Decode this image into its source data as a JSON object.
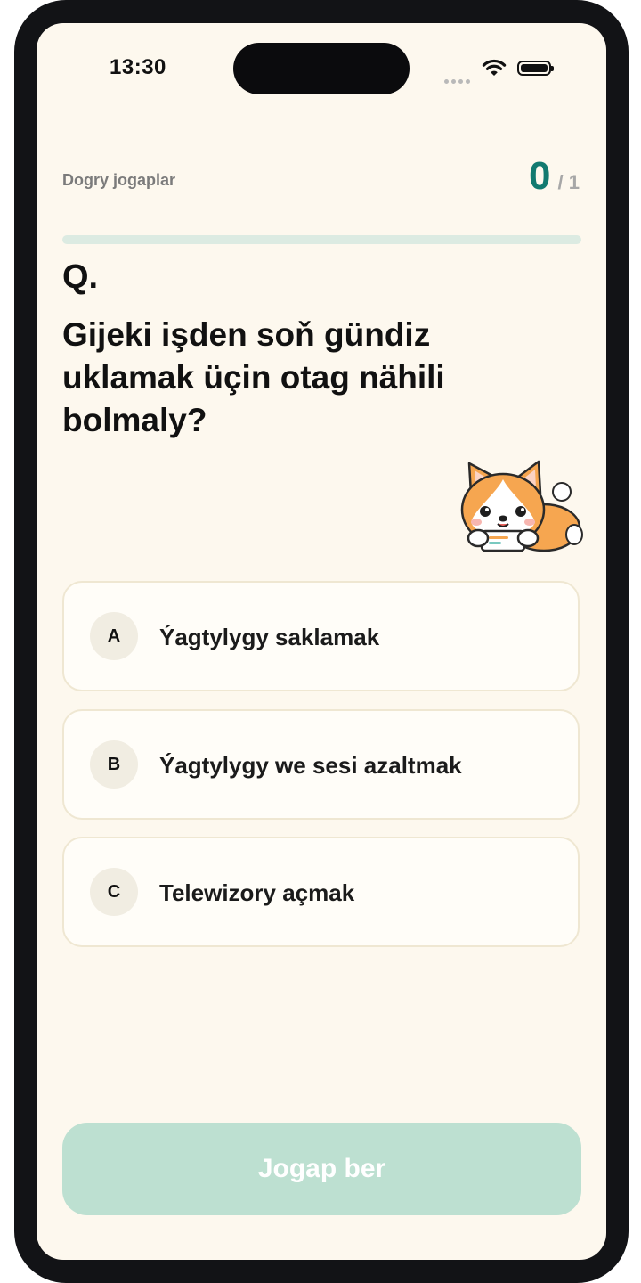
{
  "status_bar": {
    "time": "13:30",
    "icons": [
      "signal-dots-icon",
      "wifi-icon",
      "battery-icon"
    ]
  },
  "score": {
    "label": "Dogry jogaplar",
    "current": "0",
    "total": "/ 1",
    "progress_fraction": 0
  },
  "question": {
    "marker": "Q.",
    "text": "Gijeki işden soň gündiz uklamak üçin otag nähili bolmaly?"
  },
  "mascot": "corgi-mascot",
  "options": [
    {
      "letter": "A",
      "text": "Ýagtylygy saklamak"
    },
    {
      "letter": "B",
      "text": "Ýagtylygy we sesi azaltmak"
    },
    {
      "letter": "C",
      "text": "Telewizory açmak"
    }
  ],
  "submit": {
    "label": "Jogap ber",
    "state": "disabled"
  },
  "colors": {
    "background": "#fdf8ee",
    "accent": "#127a70",
    "progress_track": "#dcebe2",
    "submit_disabled": "#bde0d1",
    "option_border": "#efe7d2"
  }
}
